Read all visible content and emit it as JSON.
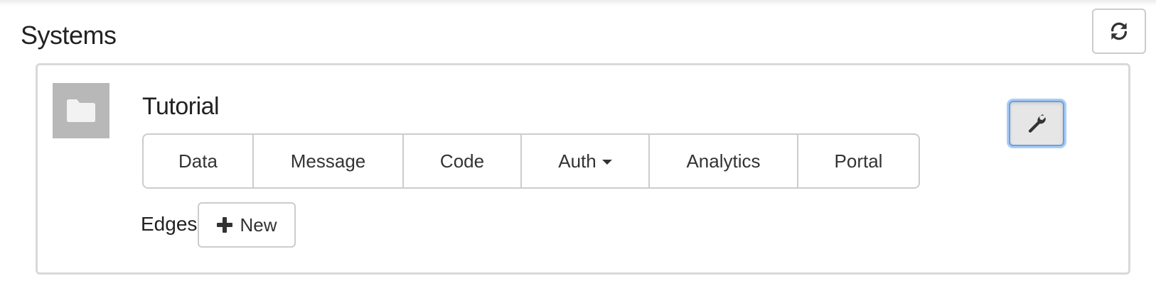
{
  "header": {
    "title": "Systems",
    "refresh_icon": "refresh-icon"
  },
  "system": {
    "name": "Tutorial",
    "thumbnail_icon": "folder-icon",
    "tabs": [
      {
        "label": "Data"
      },
      {
        "label": "Message"
      },
      {
        "label": "Code"
      },
      {
        "label": "Auth",
        "has_dropdown": true
      },
      {
        "label": "Analytics"
      },
      {
        "label": "Portal"
      }
    ],
    "edges": {
      "label": "Edges",
      "new_button_label": "New",
      "new_button_icon": "plus-icon"
    },
    "settings_icon": "wrench-icon"
  },
  "colors": {
    "border": "#cccccc",
    "thumbnail_bg": "#b8b8b8",
    "focus_ring": "#a9cdf6",
    "text": "#333333"
  }
}
